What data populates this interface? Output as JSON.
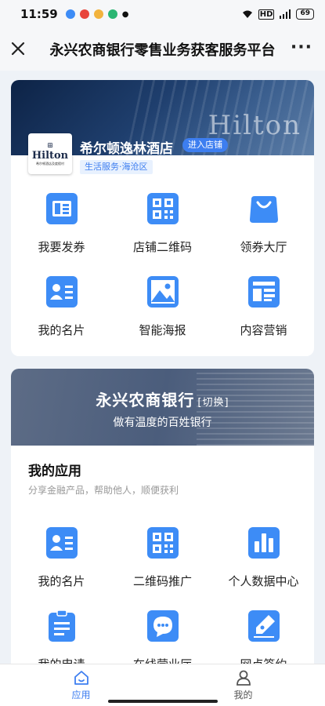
{
  "status_bar": {
    "time": "11:59",
    "battery": "69",
    "app_icons": [
      "video-app-icon",
      "weibo-icon",
      "game-app-icon",
      "play-app-icon"
    ]
  },
  "header": {
    "title": "永兴农商银行零售业务获客服务平台"
  },
  "store": {
    "name": "希尔顿逸林酒店",
    "enter_label": "进入店铺",
    "tag": "生活服务·海沧区",
    "logo_text": "Hilton",
    "logo_subtext": "希尔顿酒店及度假村",
    "banner_watermark": "Hilton",
    "items": [
      {
        "label": "我要发券",
        "icon": "coupon-icon"
      },
      {
        "label": "店铺二维码",
        "icon": "qrcode-icon"
      },
      {
        "label": "领券大厅",
        "icon": "shopping-bag-icon"
      },
      {
        "label": "我的名片",
        "icon": "business-card-icon"
      },
      {
        "label": "智能海报",
        "icon": "poster-image-icon"
      },
      {
        "label": "内容营销",
        "icon": "content-layout-icon"
      }
    ]
  },
  "bank": {
    "name": "永兴农商银行",
    "switch_label": "[切换]",
    "slogan": "做有温度的百姓银行",
    "section_title": "我的应用",
    "section_subtitle": "分享金融产品，帮助他人，顺便获利",
    "apps": [
      {
        "label": "我的名片",
        "icon": "business-card-icon"
      },
      {
        "label": "二维码推广",
        "icon": "qrcode-icon"
      },
      {
        "label": "个人数据中心",
        "icon": "bar-chart-icon"
      },
      {
        "label": "我的申请",
        "icon": "clipboard-icon"
      },
      {
        "label": "在线营业厅",
        "icon": "chat-bubble-icon"
      },
      {
        "label": "网点签约",
        "icon": "pen-sign-icon"
      }
    ]
  },
  "bottom_nav": {
    "items": [
      {
        "label": "应用",
        "icon": "home-icon",
        "active": true
      },
      {
        "label": "我的",
        "icon": "user-icon",
        "active": false
      }
    ]
  },
  "colors": {
    "accent": "#3d7ef0",
    "icon_blue": "#3d8cf6",
    "page_bg": "#eef2f7"
  }
}
